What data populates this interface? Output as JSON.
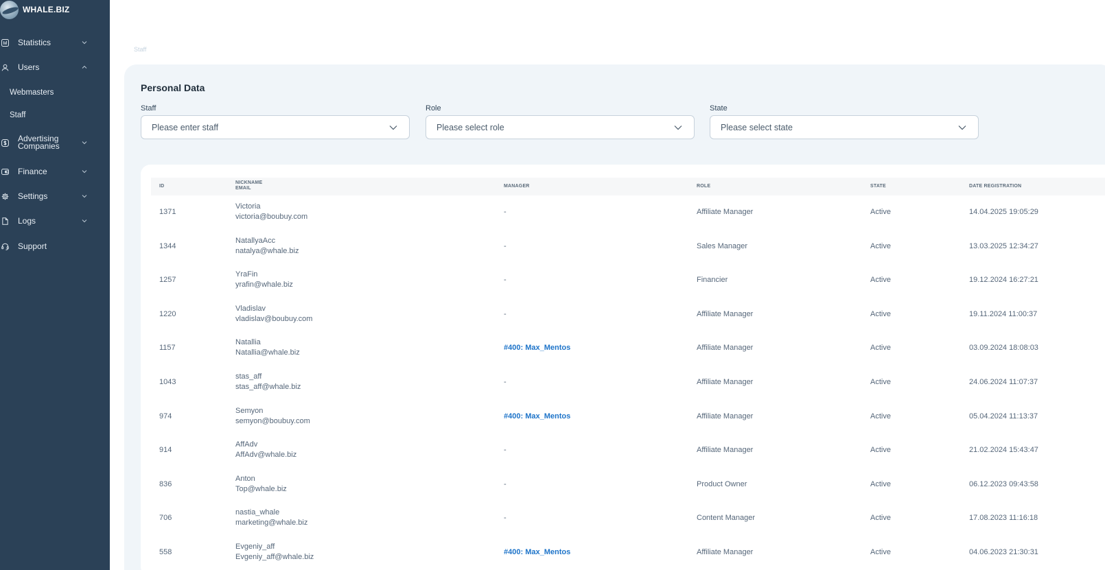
{
  "brand": {
    "name": "WHALE.BIZ"
  },
  "sidebar": {
    "items": [
      {
        "label": "Statistics",
        "icon": "bar-chart-icon",
        "expanded": false
      },
      {
        "label": "Users",
        "icon": "user-icon",
        "expanded": true,
        "children": [
          {
            "label": "Webmasters"
          },
          {
            "label": "Staff"
          }
        ]
      },
      {
        "label": "Advertising Companies",
        "label_line1": "Advertising",
        "label_line2": "Companies",
        "icon": "dollar-icon",
        "expanded": false
      },
      {
        "label": "Finance",
        "icon": "wallet-icon",
        "expanded": false
      },
      {
        "label": "Settings",
        "icon": "gear-icon",
        "expanded": false
      },
      {
        "label": "Logs",
        "icon": "document-icon",
        "expanded": false
      },
      {
        "label": "Support",
        "icon": "headset-icon"
      }
    ]
  },
  "breadcrumb": "Staff",
  "page": {
    "title": "Personal Data",
    "filters": [
      {
        "label": "Staff",
        "placeholder": "Please enter staff"
      },
      {
        "label": "Role",
        "placeholder": "Please select role"
      },
      {
        "label": "State",
        "placeholder": "Please select state"
      }
    ]
  },
  "table": {
    "headers": {
      "id": "ID",
      "nickname": "NICKNAME",
      "email": "EMAIL",
      "manager": "MANAGER",
      "role": "ROLE",
      "state": "STATE",
      "date": "DATE REGISTRATION"
    },
    "rows": [
      {
        "id": "1371",
        "nickname": "Victoria",
        "email": "victoria@boubuy.com",
        "manager": "-",
        "role": "Affiliate Manager",
        "state": "Active",
        "date": "14.04.2025 19:05:29"
      },
      {
        "id": "1344",
        "nickname": "NatallyaAcc",
        "email": "natalya@whale.biz",
        "manager": "-",
        "role": "Sales Manager",
        "state": "Active",
        "date": "13.03.2025 12:34:27"
      },
      {
        "id": "1257",
        "nickname": "YraFin",
        "email": "yrafin@whale.biz",
        "manager": "-",
        "role": "Financier",
        "state": "Active",
        "date": "19.12.2024 16:27:21"
      },
      {
        "id": "1220",
        "nickname": "Vladislav",
        "email": "vladislav@boubuy.com",
        "manager": "-",
        "role": "Affiliate Manager",
        "state": "Active",
        "date": "19.11.2024 11:00:37"
      },
      {
        "id": "1157",
        "nickname": "Natallia",
        "email": "Natallia@whale.biz",
        "manager": "#400: Max_Mentos",
        "role": "Affiliate Manager",
        "state": "Active",
        "date": "03.09.2024 18:08:03"
      },
      {
        "id": "1043",
        "nickname": "stas_aff",
        "email": "stas_aff@whale.biz",
        "manager": "-",
        "role": "Affiliate Manager",
        "state": "Active",
        "date": "24.06.2024 11:07:37"
      },
      {
        "id": "974",
        "nickname": "Semyon",
        "email": "semyon@boubuy.com",
        "manager": "#400: Max_Mentos",
        "role": "Affiliate Manager",
        "state": "Active",
        "date": "05.04.2024 11:13:37"
      },
      {
        "id": "914",
        "nickname": "AffAdv",
        "email": "AffAdv@whale.biz",
        "manager": "-",
        "role": "Affiliate Manager",
        "state": "Active",
        "date": "21.02.2024 15:43:47"
      },
      {
        "id": "836",
        "nickname": "Anton",
        "email": "Top@whale.biz",
        "manager": "-",
        "role": "Product Owner",
        "state": "Active",
        "date": "06.12.2023 09:43:58"
      },
      {
        "id": "706",
        "nickname": "nastia_whale",
        "email": "marketing@whale.biz",
        "manager": "-",
        "role": "Content Manager",
        "state": "Active",
        "date": "17.08.2023 11:16:18"
      },
      {
        "id": "558",
        "nickname": "Evgeniy_aff",
        "email": "Evgeniy_aff@whale.biz",
        "manager": "#400: Max_Mentos",
        "role": "Affiliate Manager",
        "state": "Active",
        "date": "04.06.2023 21:30:31"
      }
    ]
  },
  "colors": {
    "sidebar_bg": "#2b4157",
    "link": "#1e74c9",
    "panel_bg": "#f0f5f9"
  }
}
